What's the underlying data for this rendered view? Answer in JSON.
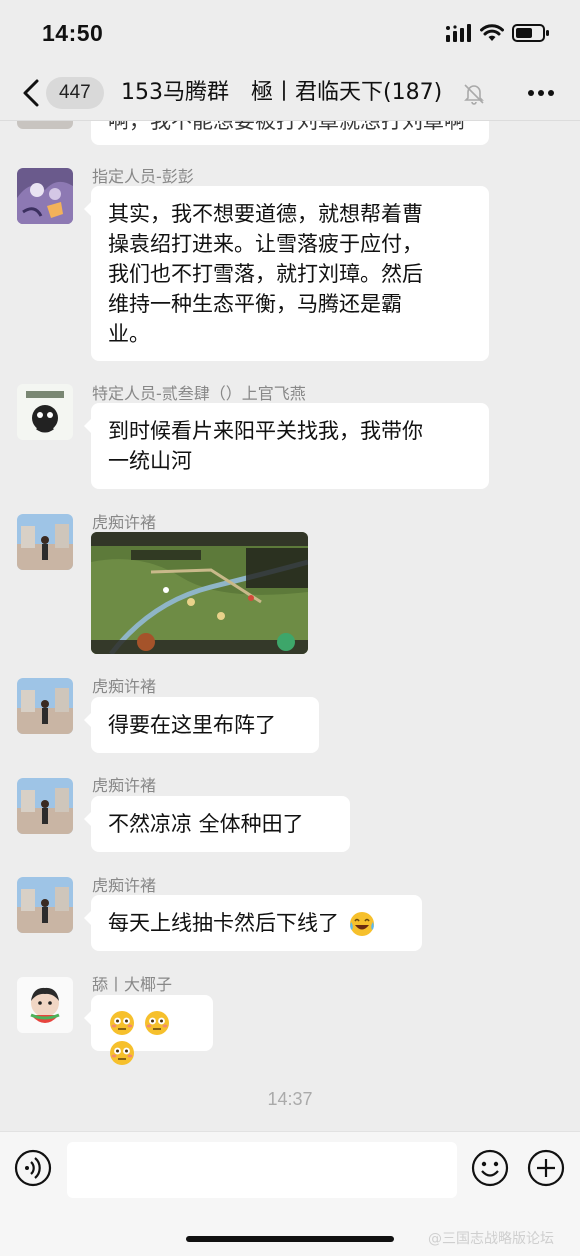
{
  "status": {
    "time": "14:50"
  },
  "nav": {
    "unread": "447",
    "title": "153马腾群　極丨君临天下(187)"
  },
  "chat": {
    "partial_message": "啊，我不能想要被打刘章就想打刘章啊",
    "messages": [
      {
        "sender": "指定人员-彭彭",
        "lines": [
          "其实，我不想要道德，就想帮着曹",
          "操袁绍打进来。让雪落疲于应付，",
          "我们也不打雪落，就打刘璋。然后",
          "维持一种生态平衡，马腾还是霸",
          "业。"
        ]
      },
      {
        "sender": "特定人员-贰叁肆（）上官飞燕",
        "lines": [
          "到时候看片来阳平关找我，我带你",
          "一统山河"
        ]
      },
      {
        "sender": "虎痴许褚",
        "image": "game-map-screenshot"
      },
      {
        "sender": "虎痴许褚",
        "text": "得要在这里布阵了"
      },
      {
        "sender": "虎痴许褚",
        "text": "不然凉凉 全体种田了"
      },
      {
        "sender": "虎痴许褚",
        "text": "每天上线抽卡然后下线了",
        "emoji": "crying-laughing-emoji"
      },
      {
        "sender": "舔丨大椰子",
        "emoji_row": [
          "flushed-emoji",
          "flushed-emoji",
          "flushed-emoji"
        ]
      }
    ],
    "timestamp": "14:37"
  },
  "watermark": "@三国志战略版论坛",
  "colors": {
    "background": "#ededed",
    "bubble": "#ffffff",
    "sender": "#888888",
    "timestamp": "#aaaaaa"
  },
  "icons": [
    "back-arrow-icon",
    "mute-bell-icon",
    "more-icon",
    "voice-icon",
    "emoji-icon",
    "plus-icon"
  ]
}
